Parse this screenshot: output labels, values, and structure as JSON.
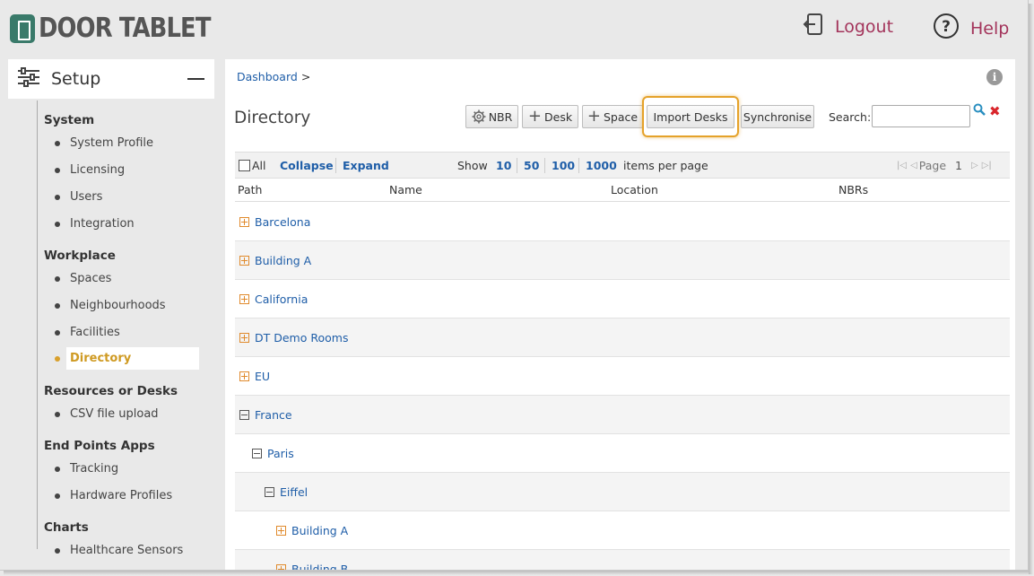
{
  "header": {
    "logo_text": "DOOR TABLET",
    "logout_label": "Logout",
    "help_label": "Help"
  },
  "sidebar": {
    "setup_label": "Setup",
    "sections": [
      {
        "title": "System",
        "items": [
          "System Profile",
          "Licensing",
          "Users",
          "Integration"
        ]
      },
      {
        "title": "Workplace",
        "items": [
          "Spaces",
          "Neighbourhoods",
          "Facilities",
          "Directory"
        ]
      },
      {
        "title": "Resources or Desks",
        "items": [
          "CSV file upload"
        ]
      },
      {
        "title": "End Points Apps",
        "items": [
          "Tracking",
          "Hardware Profiles"
        ]
      },
      {
        "title": "Charts",
        "items": [
          "Healthcare Sensors"
        ]
      }
    ],
    "active_item": "Directory"
  },
  "main": {
    "breadcrumb": "Dashboard",
    "breadcrumb_sep": ">",
    "title": "Directory",
    "toolbar": {
      "nbr_label": "NBR",
      "desk_label": "Desk",
      "space_label": "Space",
      "import_label": "Import Desks",
      "sync_label": "Synchronise",
      "search_label": "Search:",
      "search_value": ""
    },
    "listbar": {
      "all_label": "All",
      "collapse_label": "Collapse",
      "expand_label": "Expand",
      "show_label": "Show",
      "page_sizes": [
        "10",
        "50",
        "100",
        "1000"
      ],
      "items_per_page_label": "items per page",
      "page_label": "Page",
      "page_number": "1"
    },
    "columns": [
      "Path",
      "Name",
      "Location",
      "NBRs"
    ],
    "rows": [
      {
        "label": "Barcelona",
        "state": "plus",
        "depth": 0
      },
      {
        "label": "Building A",
        "state": "plus",
        "depth": 0
      },
      {
        "label": "California",
        "state": "plus",
        "depth": 0
      },
      {
        "label": "DT Demo Rooms",
        "state": "plus",
        "depth": 0
      },
      {
        "label": "EU",
        "state": "plus",
        "depth": 0
      },
      {
        "label": "France",
        "state": "minus",
        "depth": 0
      },
      {
        "label": "Paris",
        "state": "minus",
        "depth": 1
      },
      {
        "label": "Eiffel",
        "state": "minus",
        "depth": 2
      },
      {
        "label": "Building A",
        "state": "plus",
        "depth": 3
      },
      {
        "label": "Building B",
        "state": "plus",
        "depth": 3
      }
    ]
  },
  "colors": {
    "accent": "#a3345b",
    "link": "#1f5ea8",
    "active": "#cf9a22",
    "highlight": "#e5a22a"
  }
}
